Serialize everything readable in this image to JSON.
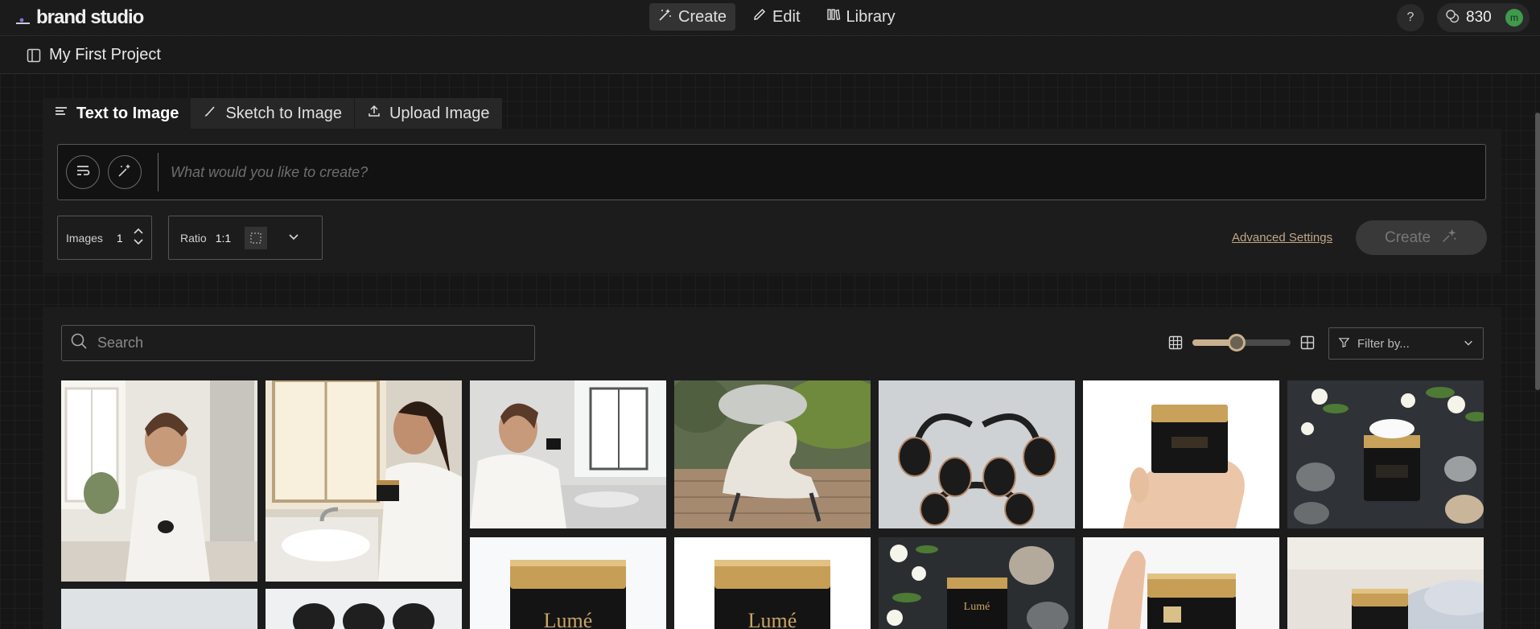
{
  "app": {
    "brand": "brand studio"
  },
  "nav": [
    {
      "label": "Create",
      "icon": "magic-wand-icon",
      "active": true
    },
    {
      "label": "Edit",
      "icon": "pencil-icon",
      "active": false
    },
    {
      "label": "Library",
      "icon": "library-icon",
      "active": false
    }
  ],
  "header": {
    "help": "?",
    "credits": "830",
    "avatar_initial": "m"
  },
  "project": {
    "title": "My First Project"
  },
  "tabs": [
    {
      "label": "Text to Image",
      "icon": "lines-icon",
      "active": true
    },
    {
      "label": "Sketch to Image",
      "icon": "brush-icon",
      "active": false
    },
    {
      "label": "Upload Image",
      "icon": "upload-icon",
      "active": false
    }
  ],
  "prompt": {
    "placeholder": "What would you like to create?",
    "value": ""
  },
  "settings": {
    "images_label": "Images",
    "images_value": "1",
    "ratio_label": "Ratio",
    "ratio_value": "1:1",
    "advanced_label": "Advanced Settings",
    "create_label": "Create"
  },
  "gallery": {
    "search_placeholder": "Search",
    "zoom_level": 0.45,
    "filter_placeholder": "Filter by...",
    "images": [
      {
        "subject": "woman smiling applying cream at bathroom mirror"
      },
      {
        "subject": "woman in white robe holding jar by window"
      },
      {
        "subject": "woman in robe smelling jar in bathroom"
      },
      {
        "subject": "woven lounge chair on wooden deck"
      },
      {
        "subject": "three black headphones on grey"
      },
      {
        "subject": "hand holding black jar with gold lid"
      },
      {
        "subject": "open cream jar with stones and white flowers"
      },
      {
        "subject": "woman product shot grey background"
      },
      {
        "subject": "black headphones top view"
      },
      {
        "subject": "Lumé black jar with gold lid"
      },
      {
        "subject": "Lumé black jar with gold lid"
      },
      {
        "subject": "Lumé jar on slate with flowers and stones"
      },
      {
        "subject": "hand holding jar with gold lid"
      },
      {
        "subject": "jar with gold lid on towels"
      }
    ]
  },
  "colors": {
    "accent": "#c9b08e",
    "avatar": "#3f9a4b",
    "background": "#161616"
  }
}
